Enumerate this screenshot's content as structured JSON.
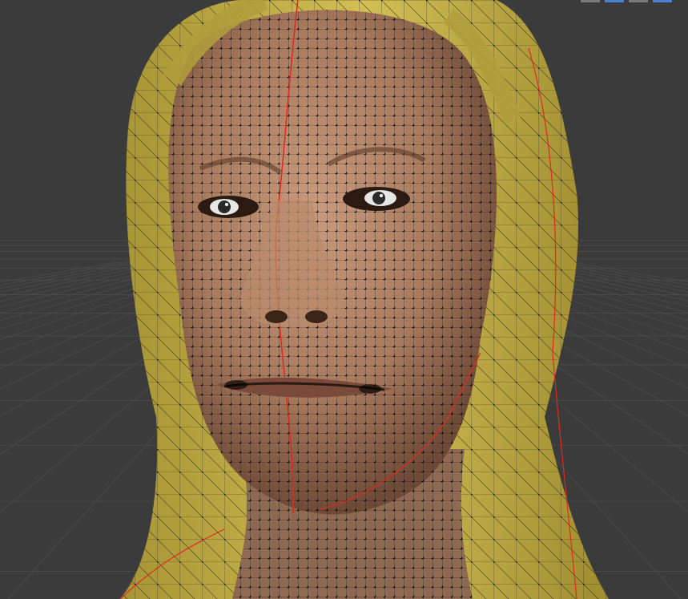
{
  "viewport": {
    "mode": "edit-mode-wireframe-overlay",
    "background_color": "#3b3b3b",
    "grid_color": "#4a4a4a",
    "colors": {
      "skin": "#b58a6d",
      "skin_shadow": "#7a5440",
      "hood": "#c9b54a",
      "hood_shadow": "#8c7b2a",
      "wire": "#111111",
      "seam": "#e0281e",
      "vertex": "#000000"
    }
  },
  "header_buttons": [
    {
      "icon": "view-toggle-icon",
      "active": false
    },
    {
      "icon": "overlay-toggle-icon",
      "active": true
    },
    {
      "icon": "shading-toggle-icon",
      "active": false
    },
    {
      "icon": "shading-solid-icon",
      "active": true
    }
  ]
}
